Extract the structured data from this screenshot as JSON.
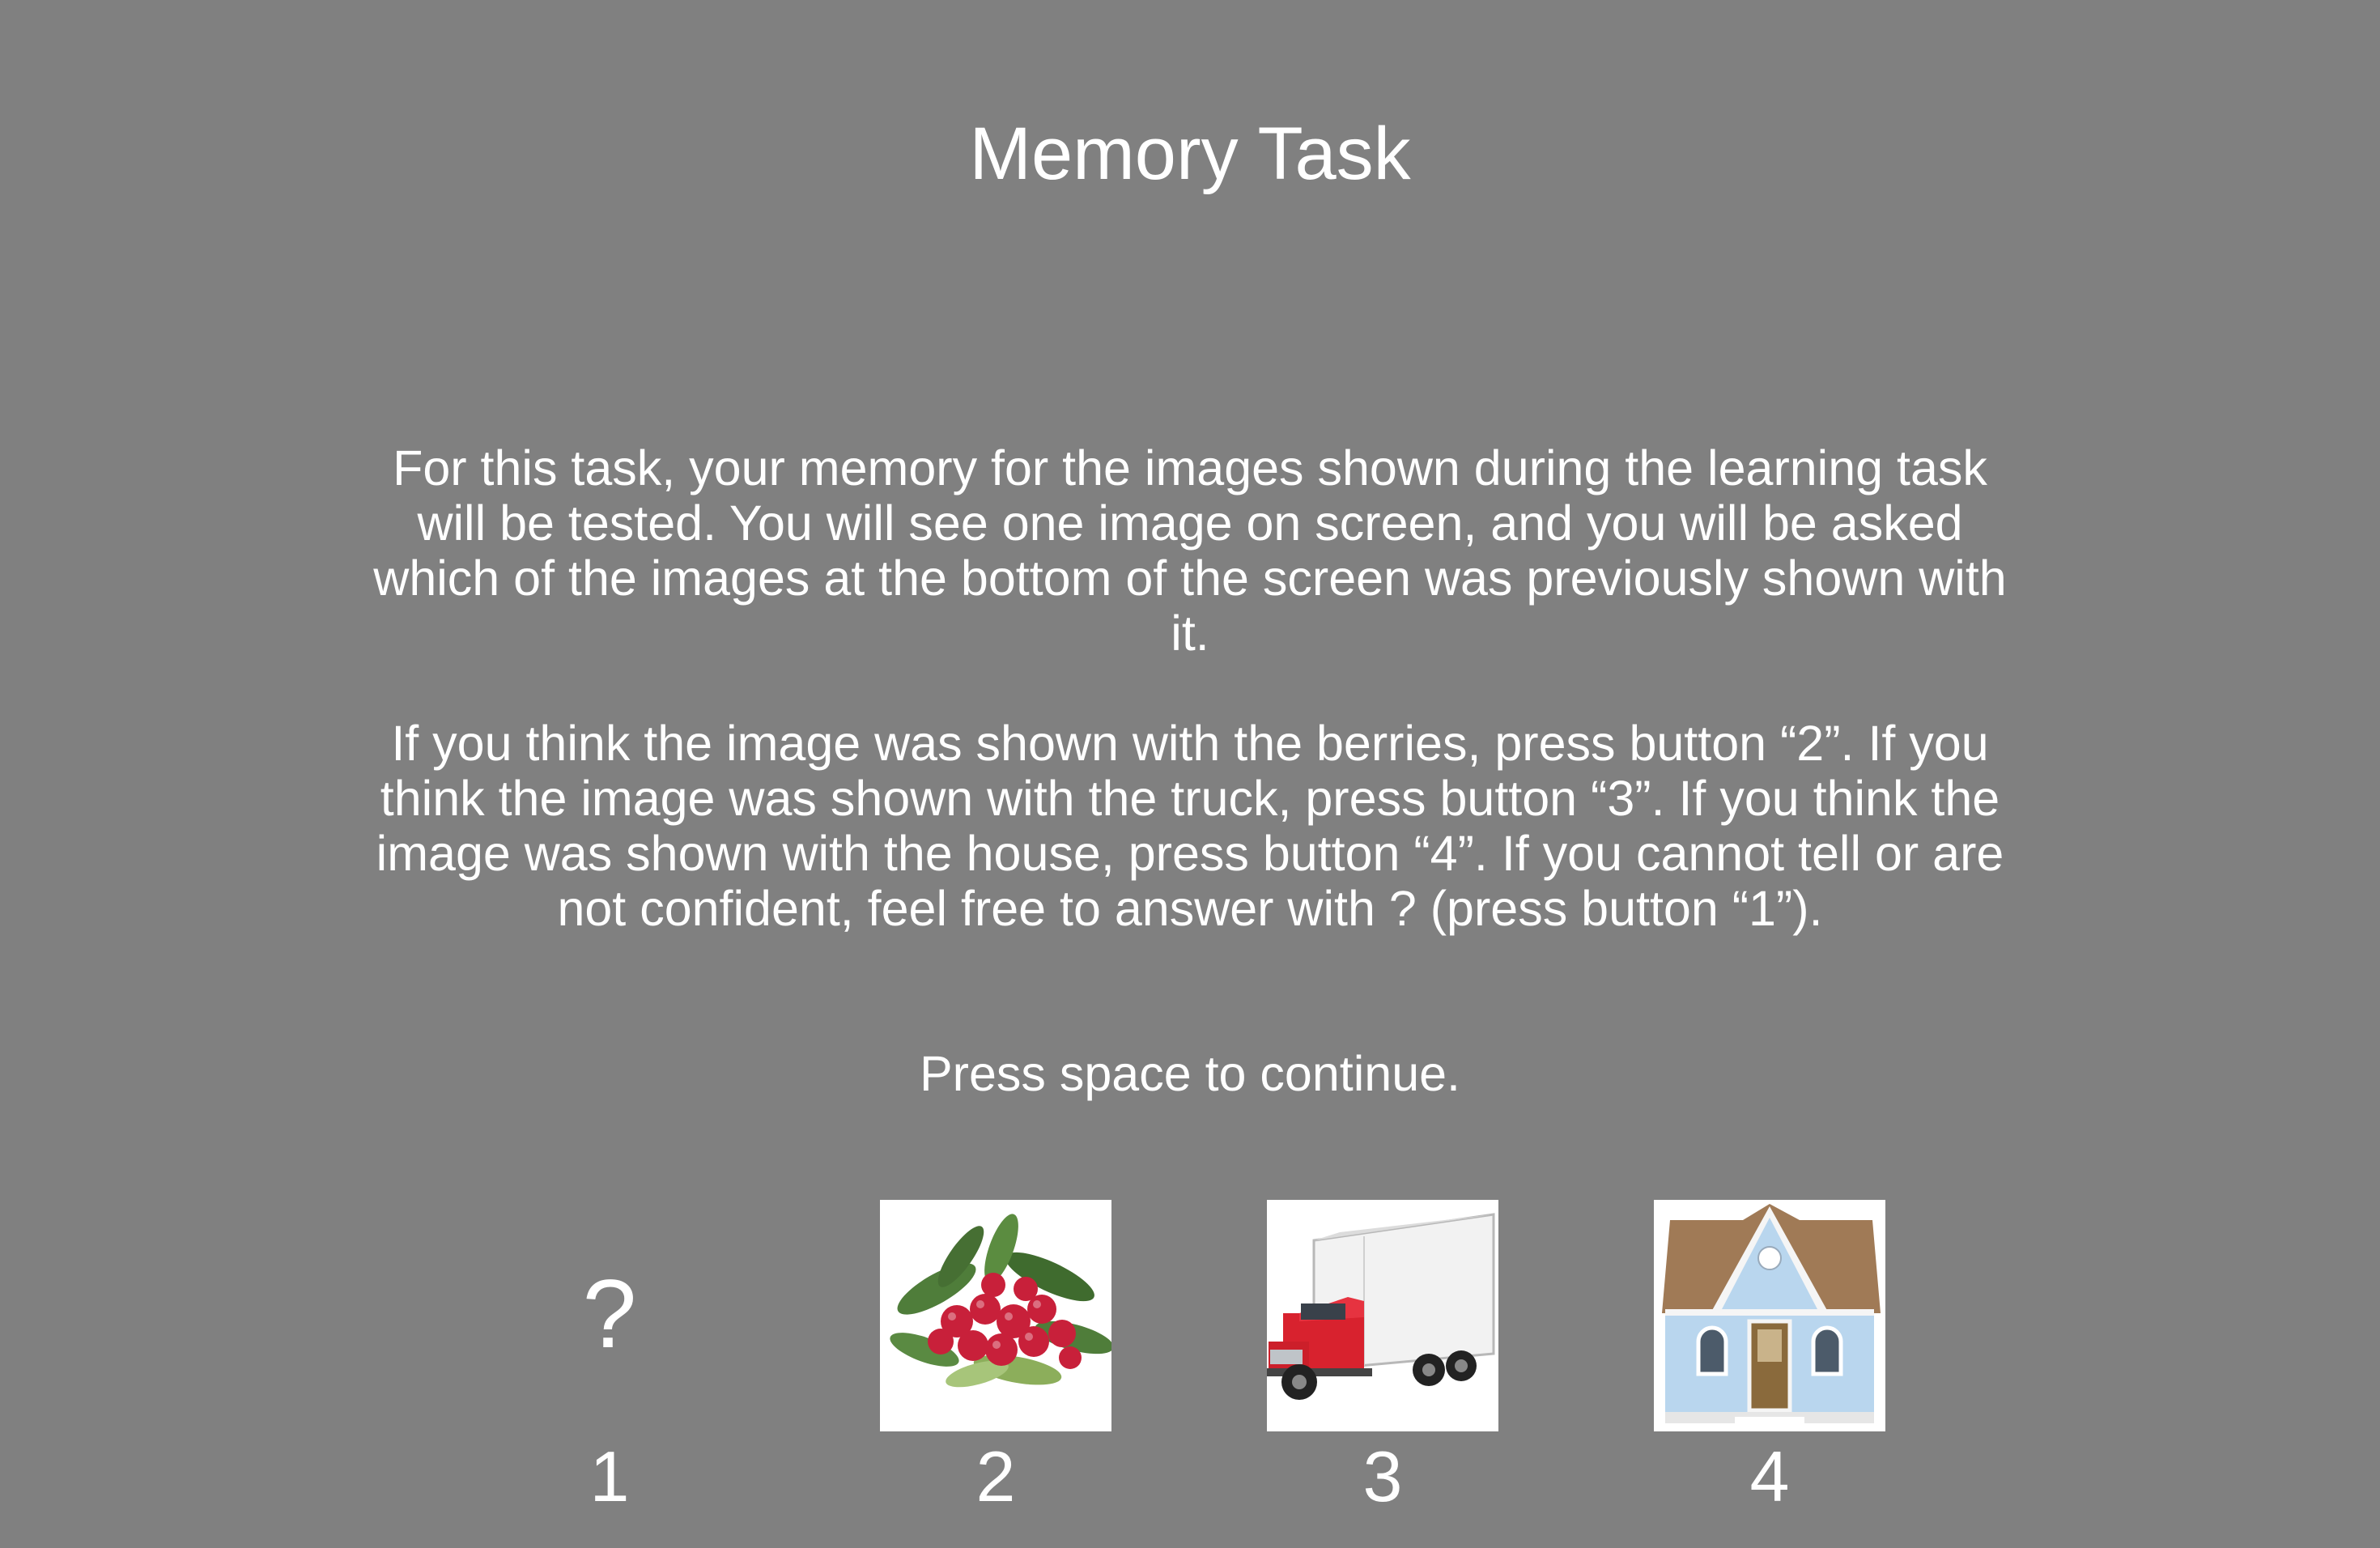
{
  "title": "Memory Task",
  "instructions": {
    "paragraph1": "For this task, your memory for the images shown during the learning task will be tested. You will see one image on screen, and you will be asked which of the images at the bottom of the screen was previously shown with it.",
    "paragraph2": "If you think the image was shown with the berries,  press button “2”. If you think the image was shown with the truck,  press button “3”. If you think the image was shown with the house, press button “4”. If you cannot tell or are not confident, feel free to answer with ? (press button “1”).",
    "paragraph3": "Press space to continue."
  },
  "options": [
    {
      "symbol": "?",
      "number": "1",
      "icon": "question-mark"
    },
    {
      "number": "2",
      "icon": "berries-image"
    },
    {
      "number": "3",
      "icon": "truck-image"
    },
    {
      "number": "4",
      "icon": "house-image"
    }
  ]
}
